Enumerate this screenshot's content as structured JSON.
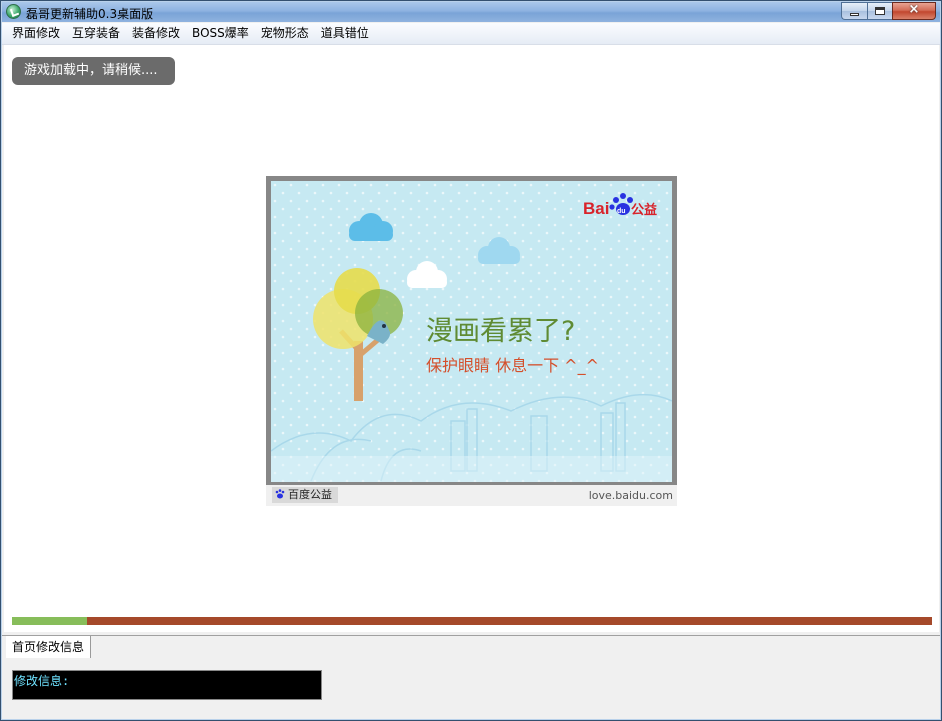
{
  "window": {
    "title": "磊哥更新辅助0.3桌面版",
    "controls": {
      "minimize": "minimize-icon",
      "maximize": "maximize-icon",
      "close": "×"
    }
  },
  "menu": {
    "items": [
      "界面修改",
      "互穿装备",
      "装备修改",
      "BOSS爆率",
      "宠物形态",
      "道具错位"
    ]
  },
  "loading": {
    "text": "游戏加载中，请稍候...."
  },
  "ad": {
    "brand_text": "Bai",
    "brand_paw": "du",
    "brand_suffix": "公益",
    "headline": "漫画看累了?",
    "subline": "保护眼睛 休息一下 ^_^",
    "footer_tag": "百度公益",
    "footer_url": "love.baidu.com"
  },
  "progress": {
    "fraction": 0.082
  },
  "tabs": [
    {
      "label": "首页修改信息"
    }
  ],
  "info": {
    "label": "修改信息:"
  },
  "colors": {
    "progress_fill": "#87bd5a",
    "progress_track": "#a5492a",
    "baidu_red": "#d8232a",
    "baidu_blue": "#2932e1"
  }
}
